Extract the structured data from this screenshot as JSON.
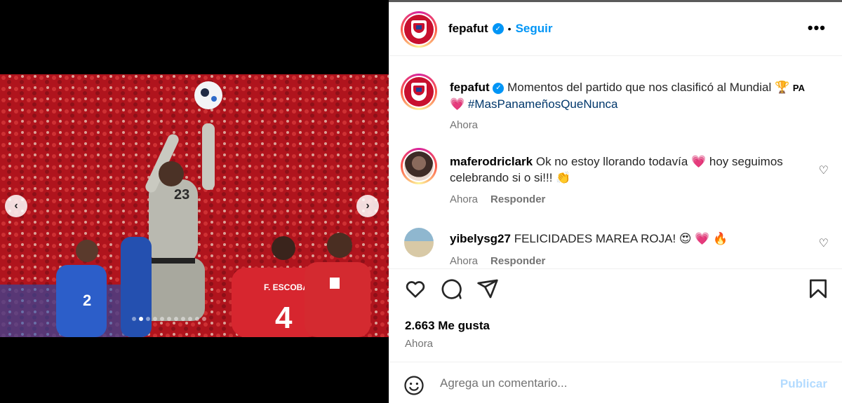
{
  "post": {
    "username": "fepafut",
    "follow_label": "Seguir",
    "more_label": "•••",
    "caption_text": "Momentos del partido que nos clasificó al Mundial 🏆",
    "caption_flag": "PA",
    "caption_heart": "💗",
    "caption_hashtag": "#MasPanameñosQueNunca",
    "caption_time": "Ahora",
    "likes": "2.663 Me gusta",
    "time": "Ahora"
  },
  "comments": [
    {
      "username": "maferodriclark",
      "text": "Ok no estoy llorando todavía 💗  hoy seguimos celebrando si o si!!! 👏",
      "time": "Ahora",
      "reply_label": "Responder"
    },
    {
      "username": "yibelysg27",
      "text": "FELICIDADES MAREA ROJA! 😍 💗 🔥",
      "time": "Ahora",
      "reply_label": "Responder"
    }
  ],
  "composer": {
    "placeholder": "Agrega un comentario...",
    "publish_label": "Publicar"
  },
  "media": {
    "prev_label": "‹",
    "next_label": "›",
    "slide_count": 11,
    "active_slide": 2,
    "jersey_text": "F. ESCOBAR",
    "jersey_number": "4"
  },
  "colors": {
    "accent": "#0095f6",
    "publish_disabled": "#b3dbff",
    "secondary_text": "#737373",
    "panama_red": "#c8102e"
  }
}
